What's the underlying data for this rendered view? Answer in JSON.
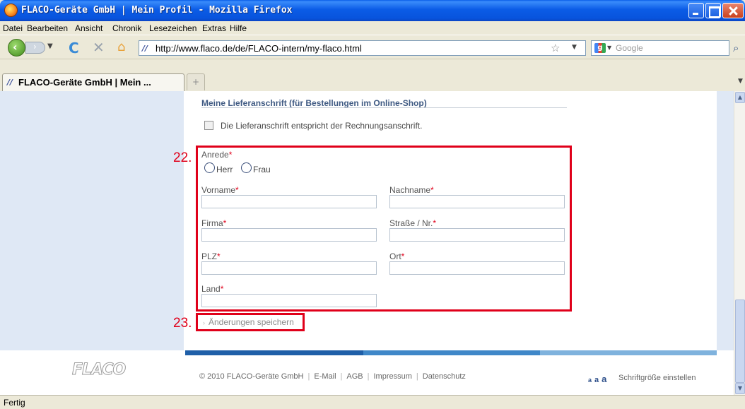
{
  "window": {
    "title": "FLACO-Geräte GmbH | Mein Profil - Mozilla Firefox",
    "app_icon": "firefox-logo",
    "controls": [
      "minimize-icon",
      "maximize-icon",
      "close-icon"
    ]
  },
  "menubar": {
    "items": [
      "Datei",
      "Bearbeiten",
      "Ansicht",
      "Chronik",
      "Lesezeichen",
      "Extras",
      "Hilfe"
    ]
  },
  "navbar": {
    "url": "http://www.flaco.de/de/FLACO-intern/my-flaco.html",
    "search_placeholder": "Google",
    "icons": [
      "back-icon",
      "forward-icon",
      "reload-icon",
      "stop-icon",
      "home-icon",
      "bookmark-star-icon",
      "search-icon"
    ]
  },
  "tabs": {
    "active_title": "FLACO-Geräte GmbH | Mein ...",
    "new_tab_label": "+"
  },
  "content": {
    "section_heading": "Meine Lieferanschrift (für Bestellungen im Online-Shop)",
    "same_address_label": "Die Lieferanschrift entspricht der Rechnungsanschrift.",
    "annotation_22": "22.",
    "annotation_23": "23.",
    "form": {
      "required_mark": "*",
      "anrede_label": "Anrede",
      "radio_herr": "Herr",
      "radio_frau": "Frau",
      "vorname_label": "Vorname",
      "nachname_label": "Nachname",
      "firma_label": "Firma",
      "strasse_label": "Straße / Nr.",
      "plz_label": "PLZ",
      "ort_label": "Ort",
      "land_label": "Land"
    },
    "save_link": "Änderungen speichern"
  },
  "footer": {
    "logo_text": "FLACO",
    "copyright": "© 2010 FLACO-Geräte GmbH",
    "links": [
      "E-Mail",
      "AGB",
      "Impressum",
      "Datenschutz"
    ],
    "font_size_a": [
      "a",
      "a",
      "a"
    ],
    "font_size_label": "Schriftgröße einstellen"
  },
  "statusbar": {
    "text": "Fertig"
  },
  "colors": {
    "accent_red": "#e0001a",
    "heading_blue": "#3f5a83",
    "sidebar_bg": "#dfe8f5",
    "footer_bar": [
      "#1f5fa8",
      "#3f87c8",
      "#7fb2dd"
    ]
  }
}
